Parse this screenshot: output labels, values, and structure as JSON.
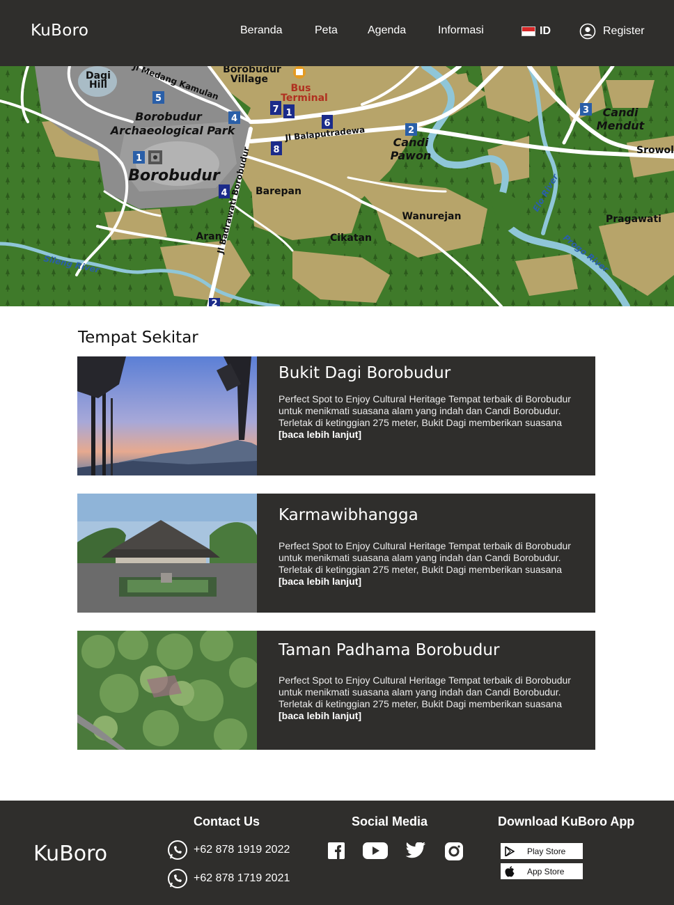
{
  "header": {
    "logo": "KuBoro",
    "nav": [
      "Beranda",
      "Peta",
      "Agenda",
      "Informasi"
    ],
    "language": "ID",
    "register": "Register"
  },
  "map": {
    "labels": {
      "dagi": "Dagi",
      "hill": "Hill",
      "medang": "Jl Medang Kamulan",
      "village1": "Borobudur",
      "village2": "Village",
      "bus1": "Bus",
      "bus2": "Terminal",
      "park1": "Borobudur",
      "park2": "Archaeological Park",
      "borobudur": "Borobudur",
      "balaputradewa": "Jl Balaputradewa",
      "badrawati": "Jl Badrawati Borobudur",
      "barepan": "Barepan",
      "candi_pawon1": "Candi",
      "candi_pawon2": "Pawon",
      "wanurejan": "Wanurejan",
      "cikatan": "Cikatan",
      "aran": "Aran",
      "sileng": "Sileng River",
      "elo": "Elo River",
      "progo": "Progo River",
      "candi_mendut1": "Candi",
      "candi_mendut2": "Mendut",
      "srowol": "Srowol",
      "pragawati": "Pragawati"
    },
    "markers": [
      "1",
      "2",
      "3",
      "4",
      "4",
      "5",
      "6",
      "7",
      "8",
      "1",
      "2"
    ]
  },
  "section": {
    "title": "Tempat Sekitar",
    "places": [
      {
        "title": "Bukit Dagi Borobudur",
        "desc": "Perfect Spot to Enjoy Cultural Heritage Tempat terbaik di Borobudur untuk menikmati suasana alam yang indah dan Candi Borobudur. Terletak di ketinggian 275 meter, Bukit Dagi memberikan suasana",
        "more": "[baca lebih lanjut]"
      },
      {
        "title": "Karmawibhangga",
        "desc": "Perfect Spot to Enjoy Cultural Heritage Tempat terbaik di Borobudur untuk menikmati suasana alam yang indah dan Candi Borobudur. Terletak di ketinggian 275 meter, Bukit Dagi memberikan suasana",
        "more": "[baca lebih lanjut]"
      },
      {
        "title": "Taman Padhama Borobudur",
        "desc": "Perfect Spot to Enjoy Cultural Heritage Tempat terbaik di Borobudur untuk menikmati suasana alam yang indah dan Candi Borobudur. Terletak di ketinggian 275 meter, Bukit Dagi memberikan suasana ",
        "more": "[baca lebih lanjut]"
      }
    ]
  },
  "footer": {
    "logo": "KuBoro",
    "contact_title": "Contact Us",
    "phones": [
      "+62 878 1919 2022",
      "+62 878 1719 2021"
    ],
    "social_title": "Social Media",
    "social_icons": [
      "facebook-icon",
      "youtube-icon",
      "twitter-icon",
      "instagram-icon"
    ],
    "download_title": "Download KuBoro App",
    "stores": [
      "Play Store",
      "App Store"
    ]
  },
  "colors": {
    "dark": "#2f2e2c",
    "forest": "#3f7a2a",
    "farmland": "#b7a46a",
    "park": "#8d8d8d",
    "river": "#8fc6d8",
    "marker": "#2a5fa8"
  }
}
